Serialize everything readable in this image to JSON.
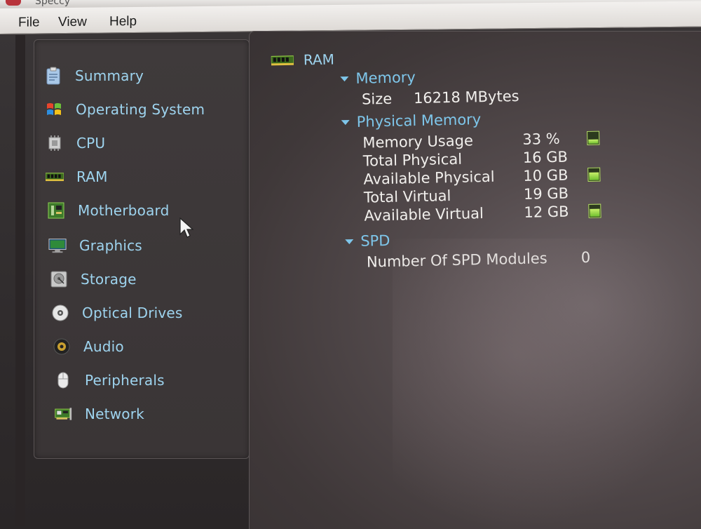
{
  "window": {
    "title": "Speccy"
  },
  "menu": {
    "items": [
      {
        "label": "File"
      },
      {
        "label": "View"
      },
      {
        "label": "Help"
      }
    ]
  },
  "sidebar": {
    "items": [
      {
        "label": "Summary",
        "icon": "clipboard-icon"
      },
      {
        "label": "Operating System",
        "icon": "windows-logo-icon"
      },
      {
        "label": "CPU",
        "icon": "cpu-chip-icon"
      },
      {
        "label": "RAM",
        "icon": "ram-stick-icon"
      },
      {
        "label": "Motherboard",
        "icon": "motherboard-icon"
      },
      {
        "label": "Graphics",
        "icon": "monitor-icon"
      },
      {
        "label": "Storage",
        "icon": "hard-drive-icon"
      },
      {
        "label": "Optical Drives",
        "icon": "disc-icon"
      },
      {
        "label": "Audio",
        "icon": "speaker-icon"
      },
      {
        "label": "Peripherals",
        "icon": "mouse-icon"
      },
      {
        "label": "Network",
        "icon": "network-card-icon"
      }
    ]
  },
  "content": {
    "root_label": "RAM",
    "memory": {
      "title": "Memory",
      "size_label": "Size",
      "size_value": "16218 MBytes"
    },
    "physical": {
      "title": "Physical Memory",
      "rows": [
        {
          "label": "Memory Usage",
          "value": "33 %",
          "meter": 0.33
        },
        {
          "label": "Total Physical",
          "value": "16 GB"
        },
        {
          "label": "Available Physical",
          "value": "10 GB",
          "meter": 0.62
        },
        {
          "label": "Total Virtual",
          "value": "19 GB"
        },
        {
          "label": "Available Virtual",
          "value": "12 GB",
          "meter": 0.63
        }
      ]
    },
    "spd": {
      "title": "SPD",
      "modules_label": "Number Of SPD Modules",
      "modules_value": "0"
    }
  },
  "colors": {
    "nav_text": "#9ed4ef",
    "section_text": "#7ec6ea",
    "value_text": "#f1efec",
    "meter_green": "#8fd44a"
  }
}
